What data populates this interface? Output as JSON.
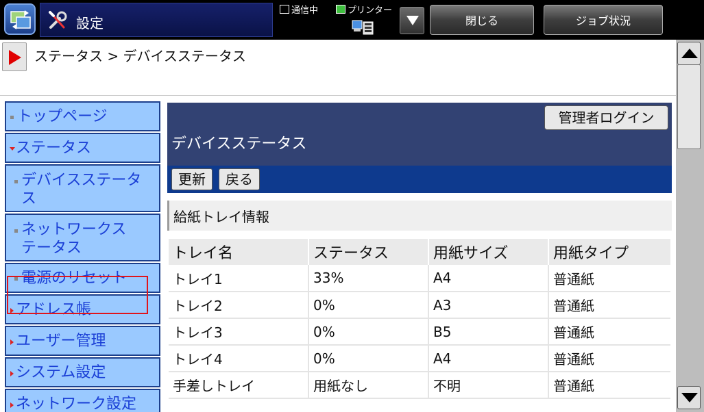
{
  "header": {
    "title": "設定",
    "comm_status": "通信中",
    "printer_status": "プリンター",
    "close_label": "閉じる",
    "job_status_label": "ジョブ状況"
  },
  "breadcrumb": "ステータス > デバイスステータス",
  "sidebar": {
    "items": [
      {
        "label": "トップページ"
      },
      {
        "label": "ステータス"
      },
      {
        "label": "デバイスステータ",
        "label2": "ス"
      },
      {
        "label": "ネットワークス",
        "label2": "テータス"
      },
      {
        "label": "電源のリセット"
      },
      {
        "label": "アドレス帳"
      },
      {
        "label": "ユーザー管理"
      },
      {
        "label": "システム設定"
      },
      {
        "label": "ネットワーク設定"
      }
    ]
  },
  "content": {
    "admin_login": "管理者ログイン",
    "page_title": "デバイスステータス",
    "refresh_label": "更新",
    "back_label": "戻る",
    "section_title": "給紙トレイ情報",
    "table": {
      "headers": [
        "トレイ名",
        "ステータス",
        "用紙サイズ",
        "用紙タイプ"
      ],
      "rows": [
        [
          "トレイ1",
          "33%",
          "A4",
          "普通紙"
        ],
        [
          "トレイ2",
          "0%",
          "A3",
          "普通紙"
        ],
        [
          "トレイ3",
          "0%",
          "B5",
          "普通紙"
        ],
        [
          "トレイ4",
          "0%",
          "A4",
          "普通紙"
        ],
        [
          "手差しトレイ",
          "用紙なし",
          "不明",
          "普通紙"
        ]
      ]
    }
  },
  "colors": {
    "nav_bg": "#9ac9ff",
    "nav_text": "#1a3fd6",
    "header_bg": "#324273",
    "toolbar_bg": "#0e3a8e",
    "highlight": "#e0151b"
  }
}
